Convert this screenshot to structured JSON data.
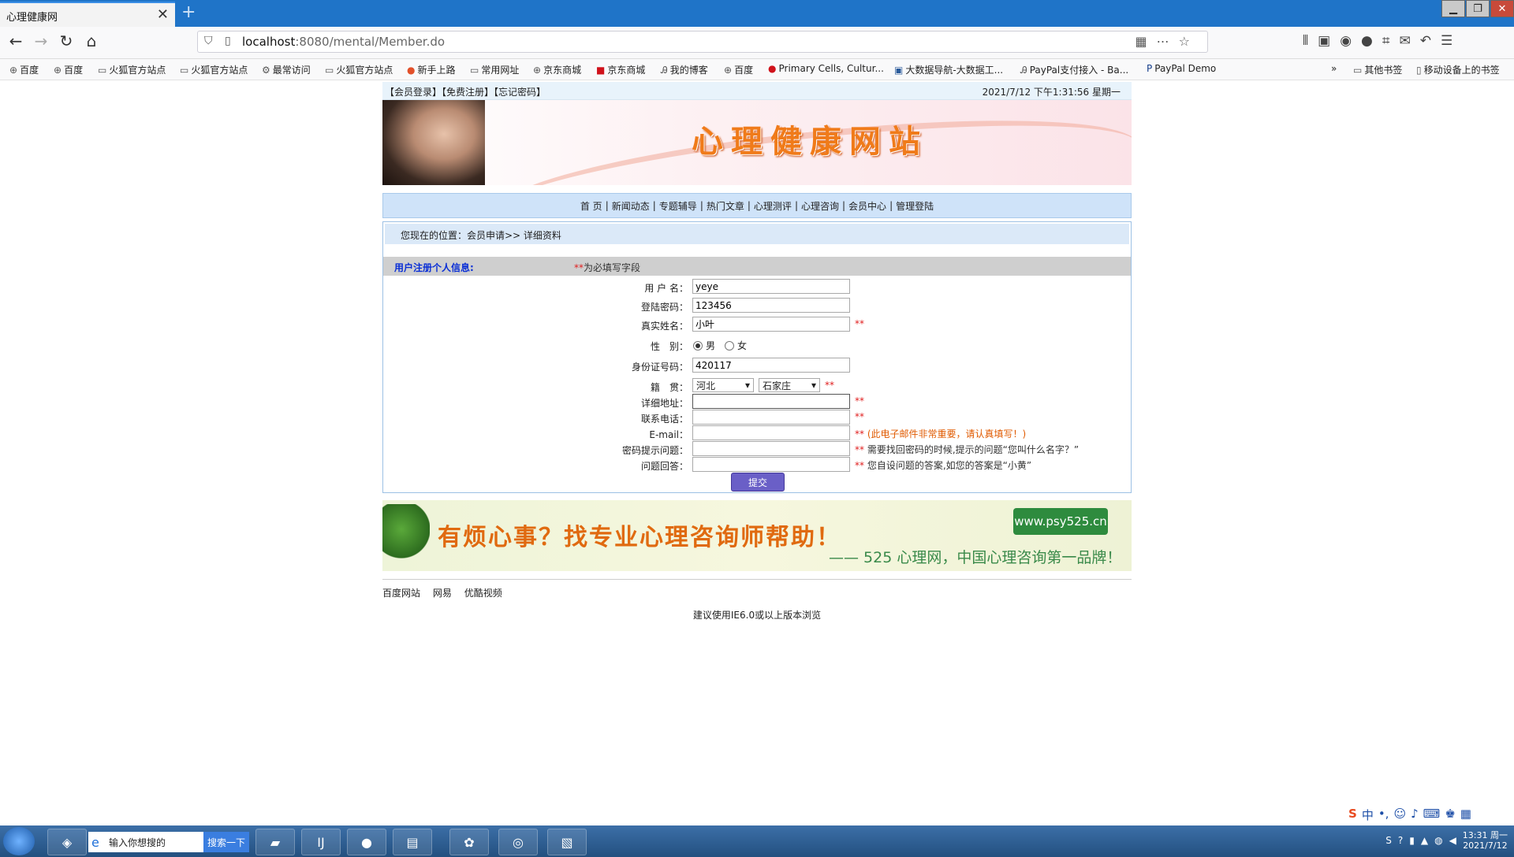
{
  "browser": {
    "tab_title": "心理健康网",
    "tab_close": "✕",
    "new_tab": "+",
    "url_host": "localhost",
    "url_rest": ":8080/mental/Member.do",
    "bookmarks": [
      "百度",
      "百度",
      "火狐官方站点",
      "火狐官方站点",
      "最常访问",
      "火狐官方站点",
      "新手上路",
      "常用网址",
      "京东商城",
      "京东商城",
      "我的博客",
      "百度",
      "Primary Cells, Cultur...",
      "大数据导航-大数据工...",
      "PayPal支付接入 - Ba...",
      "PayPal Demo"
    ],
    "other_bookmarks": "其他书签",
    "mobile_bookmarks": "移动设备上的书签"
  },
  "site": {
    "top_links": "【会员登录】【免费注册】【忘记密码】",
    "datetime": "2021/7/12 下午1:31:56  星期一",
    "banner_title": "心理健康网站",
    "nav": [
      "首 页",
      "新闻动态",
      "专题辅导",
      "热门文章",
      "心理测评",
      "心理咨询",
      "会员中心",
      "管理登陆"
    ],
    "location": "您现在的位置：会员申请>> 详细资料",
    "info_label": "用户注册个人信息:",
    "required_mark": "**",
    "required_note": "为必填写字段",
    "form": {
      "username_label": "用 户 名：",
      "username_value": "yeye",
      "password_label": "登陆密码：",
      "password_value": "123456",
      "realname_label": "真实姓名：",
      "realname_value": "小叶",
      "gender_label": "性　别：",
      "gender_male": "男",
      "gender_female": "女",
      "idcard_label": "身份证号码：",
      "idcard_value": "420117",
      "native_label": "籍　贯：",
      "province": "河北",
      "city": "石家庄",
      "address_label": "详细地址：",
      "phone_label": "联系电话：",
      "email_label": "E-mail：",
      "email_tip": "(此电子邮件非常重要，请认真填写！)",
      "question_label": "密码提示问题：",
      "question_tip": "需要找回密码的时候,提示的问题“您叫什么名字？”",
      "answer_label": "问题回答：",
      "answer_tip": "您自设问题的答案,如您的答案是“小黄”",
      "submit": "提交"
    },
    "ad": {
      "message": "有烦心事？找专业心理咨询师帮助！",
      "url": "www.psy525.cn",
      "slogan": "—— 525 心理网，中国心理咨询第一品牌！"
    },
    "footer_links": [
      "百度网站",
      "网易",
      "优酷视频"
    ],
    "footer_hint": "建议使用IE6.0或以上版本浏览"
  },
  "taskbar": {
    "search_placeholder": "输入你想搜的",
    "search_button": "搜索一下",
    "clock_time": "13:31 周一",
    "clock_date": "2021/7/12"
  },
  "ime": {
    "logo": "S",
    "lang": "中",
    "punct": "•,"
  }
}
